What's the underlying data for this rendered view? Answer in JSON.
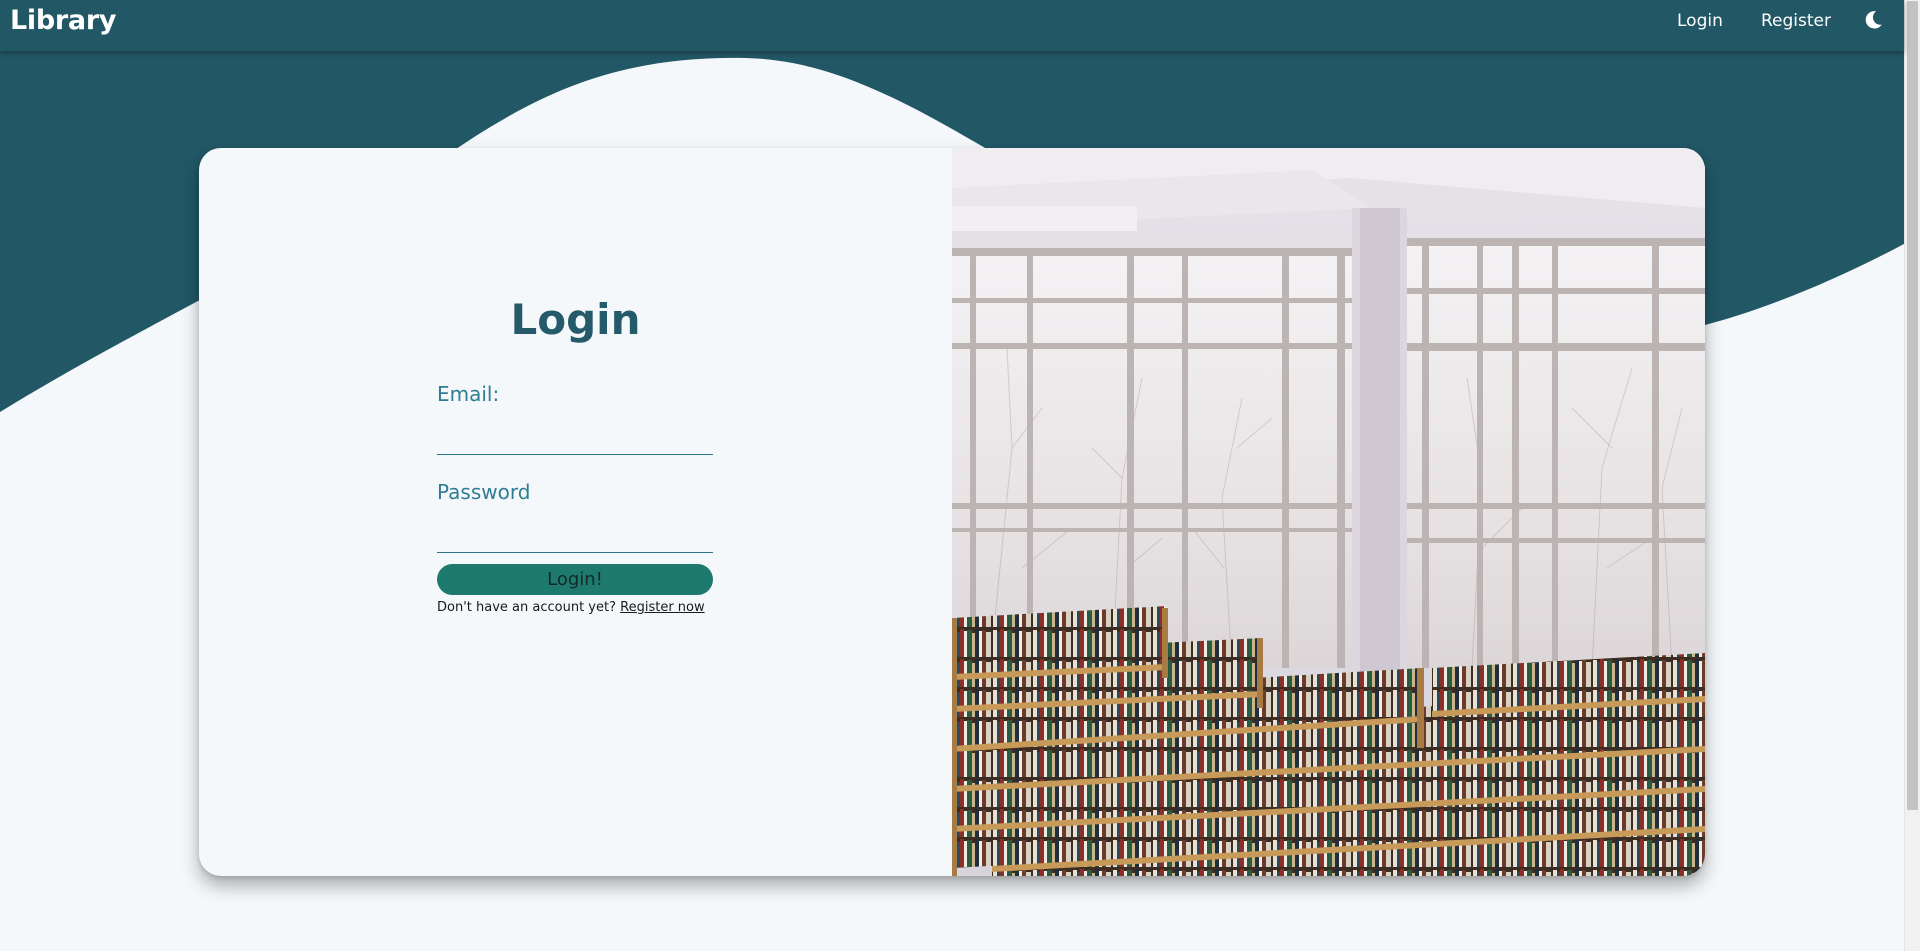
{
  "navbar": {
    "brand": "Library",
    "links": [
      "Login",
      "Register"
    ],
    "theme_icon": "moon-icon"
  },
  "login": {
    "title": "Login",
    "email_label": "Email:",
    "email_value": "",
    "password_label": "Password",
    "password_value": "",
    "submit_label": "Login!",
    "register_prompt": "Don't have an account yet?",
    "register_link": "Register now"
  },
  "image": {
    "subject": "library reading room with bookshelves and large windows"
  },
  "colors": {
    "primary": "#225766",
    "accent": "#1f7a6e",
    "label": "#2f7c94",
    "background": "#f4f8fb"
  }
}
